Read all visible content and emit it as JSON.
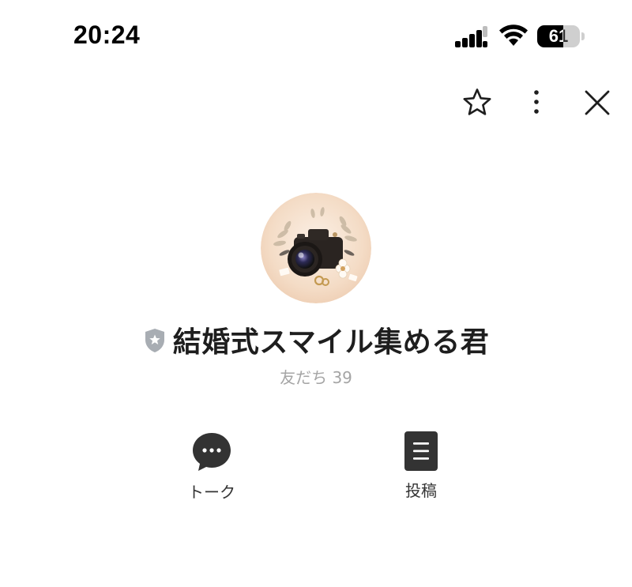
{
  "status_bar": {
    "time": "20:24",
    "battery_level": "61",
    "battery_fraction": 0.61,
    "icons": [
      "cellular-signal-icon",
      "wifi-icon",
      "battery-icon"
    ]
  },
  "header_actions": {
    "icons": [
      "star-icon",
      "more-vertical-icon",
      "close-icon"
    ]
  },
  "profile": {
    "avatar_icon": "camera-illustration",
    "badge_icon": "verified-shield-star-icon",
    "name": "結婚式スマイル集める君",
    "friends": "友だち 39"
  },
  "actions": {
    "talk_label": "トーク",
    "talk_icon": "chat-bubble-icon",
    "post_label": "投稿",
    "post_icon": "post-document-icon"
  },
  "colors": {
    "text_primary": "#1e1e1e",
    "text_secondary": "#a5a5a5",
    "icon_dark": "#333333",
    "badge_gray": "#a8adb3",
    "avatar_bg": "#f4dfcc"
  }
}
